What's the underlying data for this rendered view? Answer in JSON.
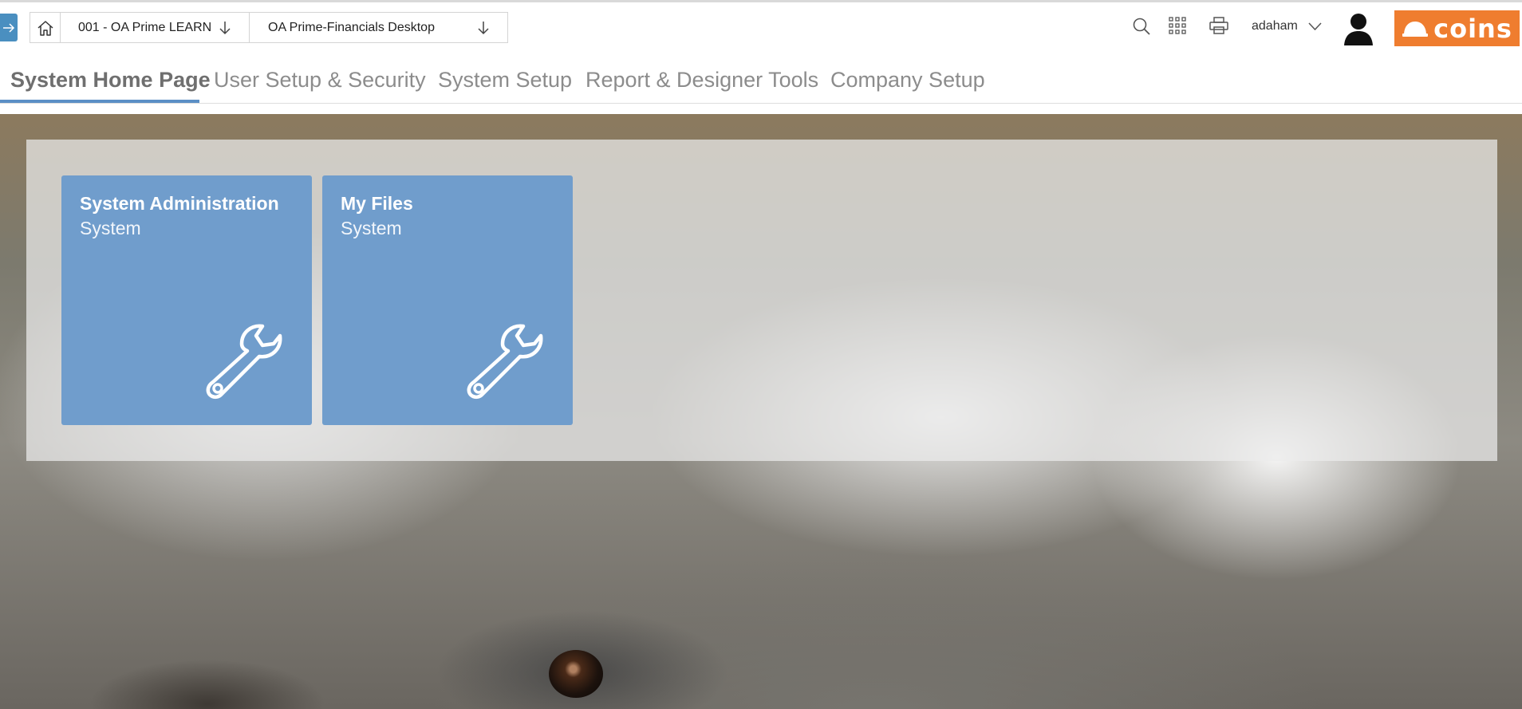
{
  "header": {
    "breadcrumbs": [
      {
        "label": "001 - OA Prime LEARN"
      },
      {
        "label": "OA Prime-Financials Desktop"
      }
    ],
    "user": {
      "name": "adaham"
    },
    "brand": {
      "logo_text": "coins",
      "color": "#ef7d2f"
    }
  },
  "tabs": [
    {
      "label": "System Home Page",
      "active": true
    },
    {
      "label": "User Setup & Security",
      "active": false
    },
    {
      "label": "System Setup",
      "active": false
    },
    {
      "label": "Report & Designer Tools",
      "active": false
    },
    {
      "label": "Company Setup",
      "active": false
    }
  ],
  "tiles": [
    {
      "title": "System Administration",
      "subtitle": "System",
      "icon": "wrench-icon"
    },
    {
      "title": "My Files",
      "subtitle": "System",
      "icon": "wrench-icon"
    }
  ],
  "colors": {
    "accent": "#4a8fc0",
    "tile": "#709dcc",
    "tab_underline": "#5b8fc5"
  }
}
